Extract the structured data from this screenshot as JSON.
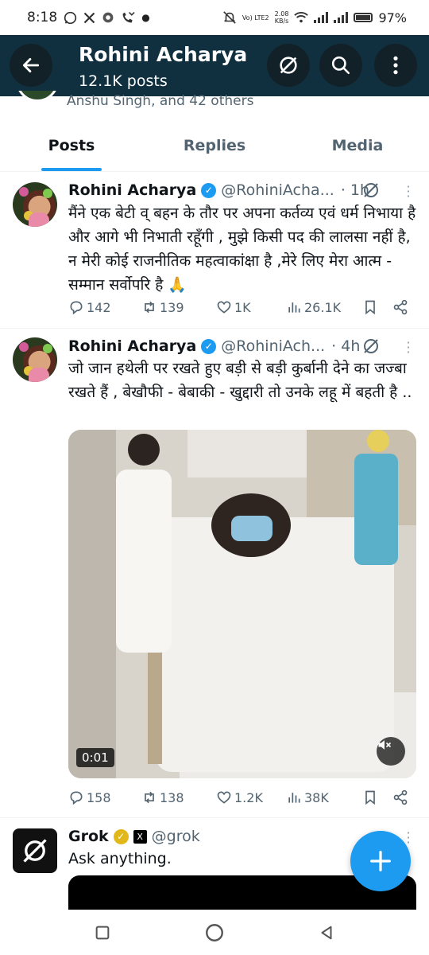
{
  "status_bar": {
    "time": "8:18",
    "notification_icons": [
      "whatsapp-icon",
      "x-icon",
      "chrome-icon",
      "missed-call-icon",
      "dot-icon"
    ],
    "network_top": "Vo) LTE2",
    "speed_value": "2.08",
    "speed_unit": "KB/s",
    "battery": "97%"
  },
  "header": {
    "name": "Rohini Acharya",
    "posts_count": "12.1K posts",
    "followed_by": "Anshu Singh, and 42 others"
  },
  "tabs": [
    {
      "label": "Posts",
      "active": true
    },
    {
      "label": "Replies",
      "active": false
    },
    {
      "label": "Media",
      "active": false
    }
  ],
  "posts": [
    {
      "name": "Rohini Acharya",
      "handle": "@RohiniAcha...",
      "time": "· 1h",
      "text": "मैंने एक बेटी व् बहन के तौर पर अपना कर्तव्य एवं धर्म निभाया है और आगे भी निभाती रहूँगी , मुझे किसी पद की लालसा नहीं है, न मेरी कोई राजनीतिक महत्वाकांक्षा है ,मेरे लिए मेरा आत्म - सम्मान सर्वोपरि है 🙏",
      "replies": "142",
      "reposts": "139",
      "likes": "1K",
      "views": "26.1K"
    },
    {
      "name": "Rohini Acharya",
      "handle": "@RohiniAch...",
      "time": "· 4h",
      "text": "जो जान हथेली पर रखते हुए बड़ी से बड़ी कुर्बानी देने का जज्बा रखते हैं , बेखौफी - बेबाकी - खुद्दारी तो उनके लहू में बहती है ..",
      "video_time": "0:01",
      "replies": "158",
      "reposts": "138",
      "likes": "1.2K",
      "views": "38K"
    }
  ],
  "grok": {
    "name": "Grok",
    "handle": "@grok",
    "text": "Ask anything."
  },
  "colors": {
    "accent": "#1d9bf0",
    "header_bg": "#10303f",
    "text": "#0f1419",
    "muted": "#536471"
  }
}
